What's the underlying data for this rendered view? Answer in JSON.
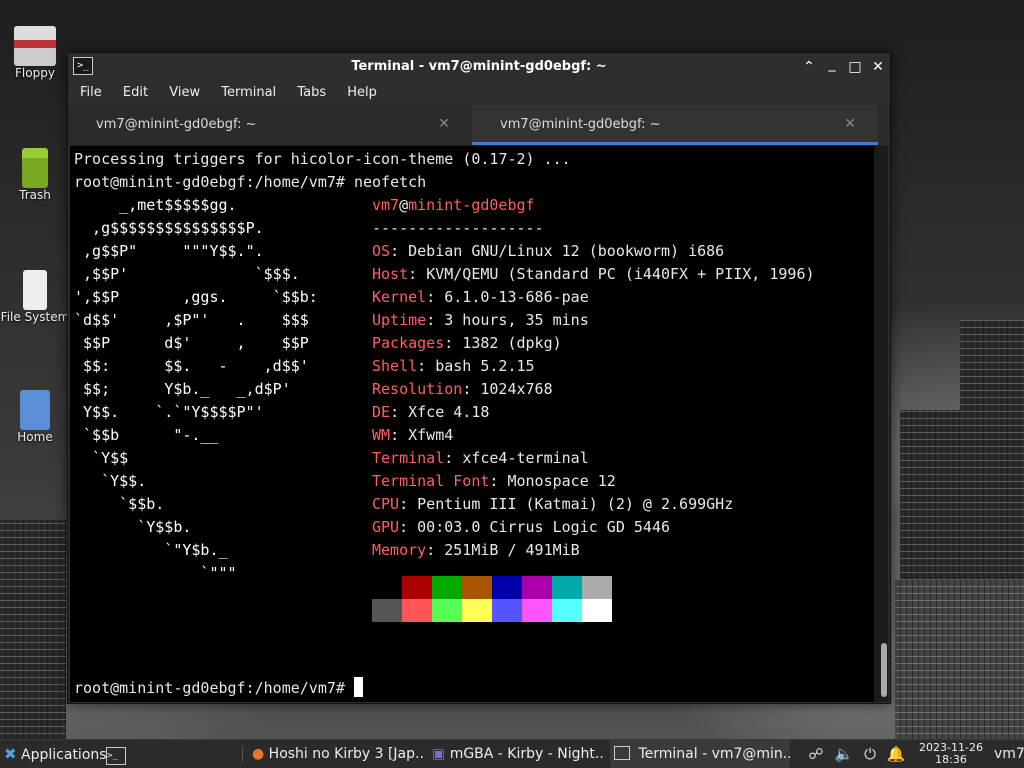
{
  "desktop": {
    "icons": [
      {
        "label": "Floppy"
      },
      {
        "label": "Trash"
      },
      {
        "label": "File System"
      },
      {
        "label": "Home"
      }
    ]
  },
  "window": {
    "title": "Terminal - vm7@minint-gd0ebgf: ~",
    "controls": {
      "minimize": "⌃",
      "restore": "_",
      "maximize": "□",
      "close": "✕"
    },
    "menu": [
      "File",
      "Edit",
      "View",
      "Terminal",
      "Tabs",
      "Help"
    ],
    "tabs": [
      {
        "label": "vm7@minint-gd0ebgf: ~",
        "active": false
      },
      {
        "label": "vm7@minint-gd0ebgf: ~",
        "active": true
      }
    ]
  },
  "terminal": {
    "line1": "Processing triggers for hicolor-icon-theme (0.17-2) ...",
    "line2_prompt": "root@minint-gd0ebgf:/home/vm7# ",
    "line2_cmd": "neofetch",
    "logo": [
      "     _,met$$$$$gg.",
      "  ,g$$$$$$$$$$$$$$$P.",
      " ,g$$P\"     \"\"\"Y$$.\".",
      " ,$$P'              `$$$.",
      "',$$P       ,ggs.     `$$b:",
      "`d$$'     ,$P\"'   .    $$$",
      " $$P      d$'     ,    $$P",
      " $$:      $$.   -    ,d$$'",
      " $$;      Y$b._   _,d$P'",
      " Y$$.    `.`\"Y$$$$P\"'",
      " `$$b      \"-.__",
      "  `Y$$",
      "   `Y$$.",
      "     `$$b.",
      "       `Y$$b.",
      "          `\"Y$b._",
      "              `\"\"\""
    ],
    "user": "vm7",
    "at": "@",
    "host": "minint-gd0ebgf",
    "separator": "-------------------",
    "info": [
      {
        "key": "OS",
        "value": "Debian GNU/Linux 12 (bookworm) i686"
      },
      {
        "key": "Host",
        "value": "KVM/QEMU (Standard PC (i440FX + PIIX, 1996)"
      },
      {
        "key": "Kernel",
        "value": "6.1.0-13-686-pae"
      },
      {
        "key": "Uptime",
        "value": "3 hours, 35 mins"
      },
      {
        "key": "Packages",
        "value": "1382 (dpkg)"
      },
      {
        "key": "Shell",
        "value": "bash 5.2.15"
      },
      {
        "key": "Resolution",
        "value": "1024x768"
      },
      {
        "key": "DE",
        "value": "Xfce 4.18"
      },
      {
        "key": "WM",
        "value": "Xfwm4"
      },
      {
        "key": "Terminal",
        "value": "xfce4-terminal"
      },
      {
        "key": "Terminal Font",
        "value": "Monospace 12"
      },
      {
        "key": "CPU",
        "value": "Pentium III (Katmai) (2) @ 2.699GHz"
      },
      {
        "key": "GPU",
        "value": "00:03.0 Cirrus Logic GD 5446"
      },
      {
        "key": "Memory",
        "value": "251MiB / 491MiB"
      }
    ],
    "palette_top": [
      "#000000",
      "#aa0000",
      "#00aa00",
      "#aa5500",
      "#0000aa",
      "#aa00aa",
      "#00aaaa",
      "#aaaaaa"
    ],
    "palette_bottom": [
      "#555555",
      "#ff5555",
      "#55ff55",
      "#ffff55",
      "#5555ff",
      "#ff55ff",
      "#55ffff",
      "#ffffff"
    ],
    "final_prompt": "root@minint-gd0ebgf:/home/vm7# "
  },
  "taskbar": {
    "apps_label": "Applications",
    "tasks": [
      {
        "label": "Hoshi no Kirby 3 [Jap..."
      },
      {
        "label": "mGBA - Kirby - Night..."
      },
      {
        "label": "Terminal - vm7@min..."
      }
    ],
    "clock_date": "2023-11-26",
    "clock_time": "18:36",
    "user": "vm7"
  }
}
